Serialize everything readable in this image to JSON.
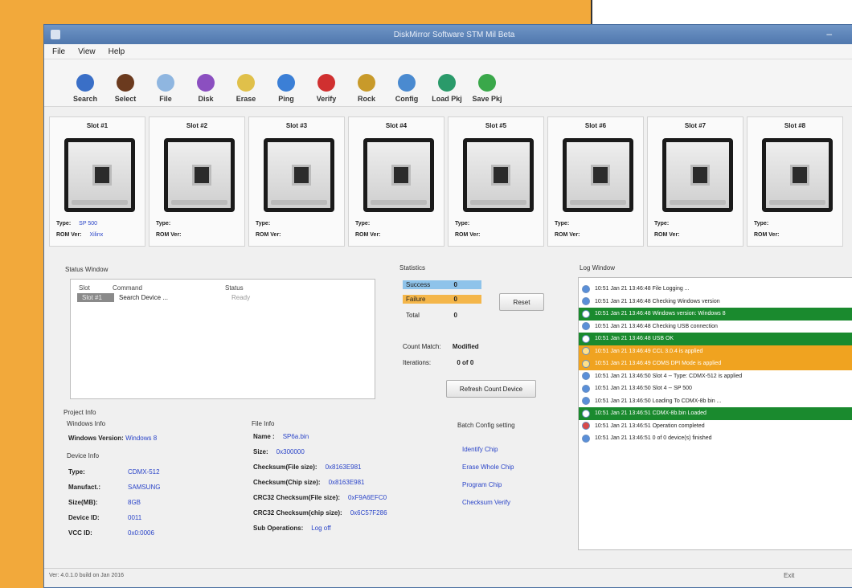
{
  "window": {
    "title": "DiskMirror Software STM Mil Beta"
  },
  "menu": [
    "File",
    "View",
    "Help"
  ],
  "toolbar": [
    {
      "label": "Search",
      "icon": "search-icon",
      "color": "#3a6fc7"
    },
    {
      "label": "Select",
      "icon": "select-icon",
      "color": "#6b3a1e"
    },
    {
      "label": "File",
      "icon": "file-icon",
      "color": "#8fb6e0"
    },
    {
      "label": "Disk",
      "icon": "disk-icon",
      "color": "#8b4fc0"
    },
    {
      "label": "Erase",
      "icon": "erase-icon",
      "color": "#e0c04a"
    },
    {
      "label": "Ping",
      "icon": "ping-icon",
      "color": "#3b7fd6"
    },
    {
      "label": "Verify",
      "icon": "verify-icon",
      "color": "#d03030"
    },
    {
      "label": "Rock",
      "icon": "rock-icon",
      "color": "#c89a2a"
    },
    {
      "label": "Config",
      "icon": "config-icon",
      "color": "#4a8ad0"
    },
    {
      "label": "Load Pkj",
      "icon": "load-icon",
      "color": "#2a9a6a"
    },
    {
      "label": "Save Pkj",
      "icon": "save-icon",
      "color": "#3aa84a"
    }
  ],
  "slots": [
    {
      "title": "Slot #1",
      "type_label": "Type:",
      "type_value": "SP 500",
      "rom_label": "ROM Ver:",
      "rom_value": "Xilinx"
    },
    {
      "title": "Slot #2",
      "type_label": "Type:",
      "type_value": "",
      "rom_label": "ROM Ver:",
      "rom_value": ""
    },
    {
      "title": "Slot #3",
      "type_label": "Type:",
      "type_value": "",
      "rom_label": "ROM Ver:",
      "rom_value": ""
    },
    {
      "title": "Slot #4",
      "type_label": "Type:",
      "type_value": "",
      "rom_label": "ROM Ver:",
      "rom_value": ""
    },
    {
      "title": "Slot #5",
      "type_label": "Type:",
      "type_value": "",
      "rom_label": "ROM Ver:",
      "rom_value": ""
    },
    {
      "title": "Slot #6",
      "type_label": "Type:",
      "type_value": "",
      "rom_label": "ROM Ver:",
      "rom_value": ""
    },
    {
      "title": "Slot #7",
      "type_label": "Type:",
      "type_value": "",
      "rom_label": "ROM Ver:",
      "rom_value": ""
    },
    {
      "title": "Slot #8",
      "type_label": "Type:",
      "type_value": "",
      "rom_label": "ROM Ver:",
      "rom_value": ""
    }
  ],
  "status_window": {
    "label": "Status Window",
    "headers": [
      "Slot",
      "Command",
      "Status"
    ],
    "rows": [
      {
        "slot": "Slot #1",
        "command": "Search Device ...",
        "status": "Ready"
      }
    ]
  },
  "statistics": {
    "label": "Statistics",
    "success_label": "Success",
    "success_value": "0",
    "success_color": "#8ec3ea",
    "failure_label": "Failure",
    "failure_value": "0",
    "failure_color": "#f4b64a",
    "total_label": "Total",
    "total_value": "0",
    "reset_label": "Reset",
    "count_label": "Count Match:",
    "count_value": "Modified",
    "iterations_label": "Iterations:",
    "iterations_value": "0 of 0",
    "refresh_label": "Refresh Count Device"
  },
  "project_info": {
    "label": "Project Info",
    "windows_label": "Windows Info",
    "windows_version_label": "Windows Version:",
    "windows_version_value": "Windows 8",
    "device_label": "Device Info",
    "device_rows": [
      {
        "label": "Type:",
        "value": "CDMX-512"
      },
      {
        "label": "Manufact.:",
        "value": "SAMSUNG"
      },
      {
        "label": "Size(MB):",
        "value": "8GB"
      },
      {
        "label": "Device ID:",
        "value": "0011"
      },
      {
        "label": "VCC ID:",
        "value": "0x0:0006"
      }
    ]
  },
  "file_info": {
    "label": "File Info",
    "rows": [
      {
        "label": "Name :",
        "value": "SP6a.bin"
      },
      {
        "label": "Size:",
        "value": "0x300000"
      },
      {
        "label": "Checksum(File size):",
        "value": "0x8163E981"
      },
      {
        "label": "Checksum(Chip size):",
        "value": "0x8163E981"
      },
      {
        "label": "CRC32 Checksum(File size):",
        "value": "0xF9A6EFC0"
      },
      {
        "label": "CRC32 Checksum(chip size):",
        "value": "0x6C57F286"
      },
      {
        "label": "Sub Operations:",
        "value": "Log off"
      }
    ]
  },
  "batch_config": {
    "label": "Batch Config setting",
    "links": [
      "Identify Chip",
      "Erase Whole Chip",
      "Program Chip",
      "Checksum Verify"
    ]
  },
  "log_window": {
    "label": "Log Window",
    "entries": [
      {
        "text": "10:51 Jan 21 13:46:48  File Logging ...",
        "style": "normal",
        "icon": "#5a8fd8"
      },
      {
        "text": "10:51 Jan 21 13:46:48  Checking Windows version",
        "style": "normal",
        "icon": "#5a8fd8"
      },
      {
        "text": "10:51 Jan 21 13:46:48  Windows version: Windows 8",
        "style": "green",
        "icon": "#ffffff"
      },
      {
        "text": "10:51 Jan 21 13:46:48  Checking USB connection",
        "style": "normal",
        "icon": "#5a8fd8"
      },
      {
        "text": "10:51 Jan 21 13:46:48  USB OK",
        "style": "green",
        "icon": "#ffffff"
      },
      {
        "text": "10:51 Jan 21 13:46:49  CCL 3.0.4 is applied",
        "style": "orange",
        "icon": "#ffe08a"
      },
      {
        "text": "10:51 Jan 21 13:46:49  COMS DPI Mode is applied",
        "style": "orange",
        "icon": "#ffe08a"
      },
      {
        "text": "10:51 Jan 21 13:46:50  Slot 4 -- Type: CDMX-512 is applied",
        "style": "normal",
        "icon": "#5a8fd8"
      },
      {
        "text": "10:51 Jan 21 13:46:50  Slot 4 -- SP 500",
        "style": "normal",
        "icon": "#5a8fd8"
      },
      {
        "text": "10:51 Jan 21 13:46:50  Loading To CDMX-8b bin ...",
        "style": "normal",
        "icon": "#5a8fd8"
      },
      {
        "text": "10:51 Jan 21 13:46:51  CDMX-8b.bin Loaded",
        "style": "green",
        "icon": "#ffffff"
      },
      {
        "text": "10:51 Jan 21 13:46:51  Operation completed",
        "style": "normal",
        "icon": "#d84a4a"
      },
      {
        "text": "10:51 Jan 21 13:46:51  0 of 0 device(s) finished",
        "style": "normal",
        "icon": "#5a8fd8"
      }
    ]
  },
  "statusbar": {
    "left": "Ver: 4.0.1.0 build on Jan 2016",
    "right": "Exit"
  }
}
